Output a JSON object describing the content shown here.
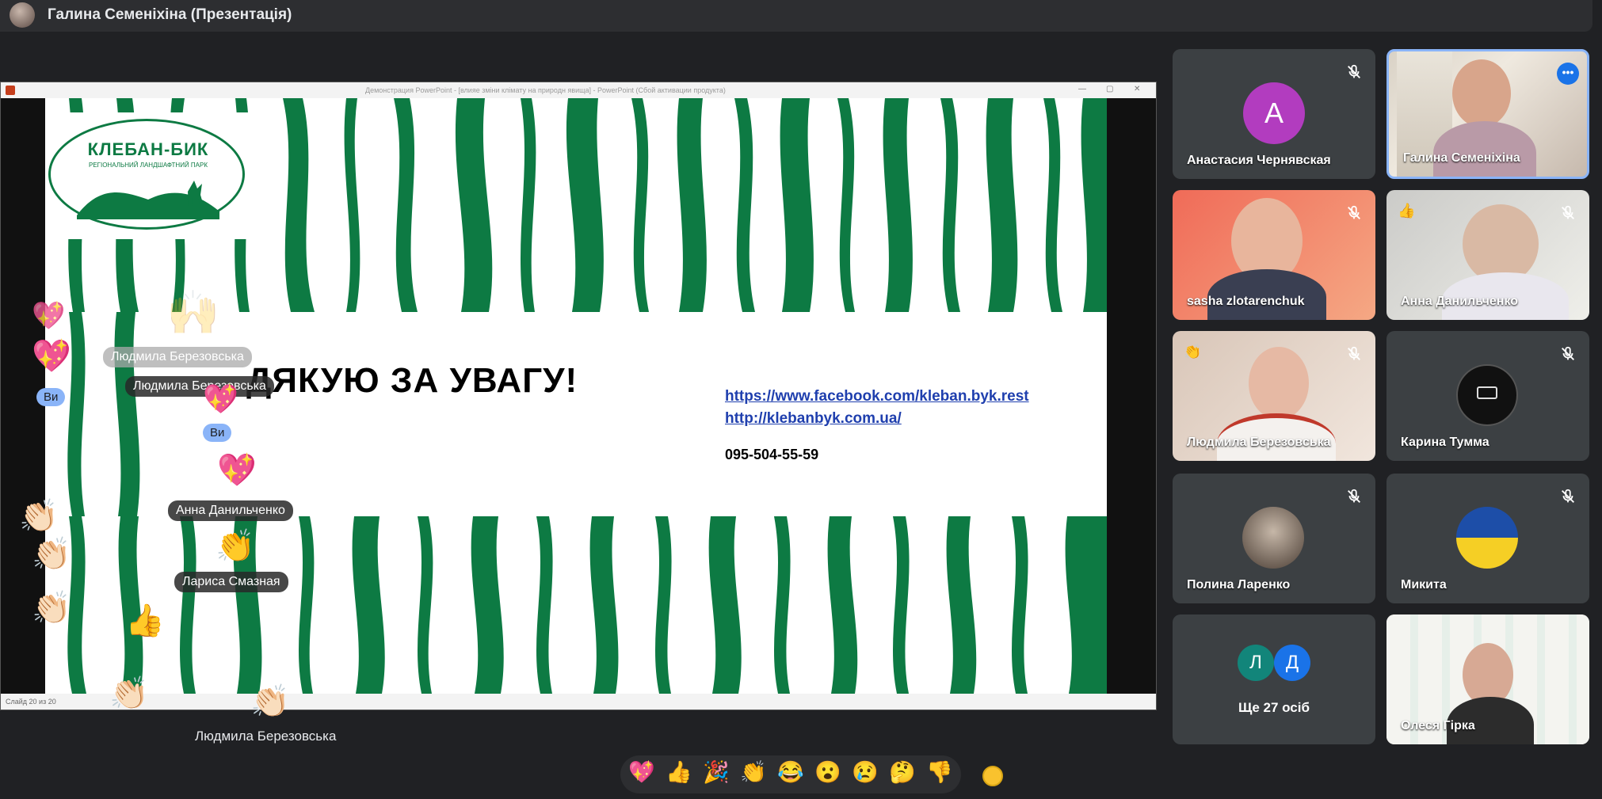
{
  "meeting": {
    "title": "Галина Семеніхіна (Презентація)"
  },
  "presentation": {
    "window_title": "Демонстрация PowerPoint - [влияе зміни клімату на природн явища] - PowerPoint (Сбой активации продукта)",
    "status_left": "Слайд 20 из 20",
    "slide": {
      "logo_name": "КЛЕБАН-БИК",
      "logo_subtitle": "РЕГІОНАЛЬНИЙ ЛАНДШАФТНИЙ ПАРК",
      "heading": "ДЯКУЮ ЗА УВАГУ!",
      "link_facebook": "https://www.facebook.com/kleban.byk.rest",
      "link_site": "http://klebanbyk.com.ua/",
      "phone": "095-504-55-59"
    }
  },
  "reactions": {
    "names": [
      "Людмила Березовська",
      "Людмила Березовська",
      "Анна Данильченко",
      "Лариса Смазная",
      "Людмила Березовська"
    ],
    "you": "Ви"
  },
  "participants": [
    {
      "name": "Анастасия Чернявская",
      "initial": "А",
      "muted": true,
      "avatar_color": "#b23cbf"
    },
    {
      "name": "Галина Семеніхіна",
      "muted": false,
      "presenting": true
    },
    {
      "name": "sasha zlotarenchuk",
      "muted": true
    },
    {
      "name": "Анна Данильченко",
      "muted": true,
      "reaction": "👍"
    },
    {
      "name": "Людмила Березовська",
      "muted": true,
      "reaction": "👏"
    },
    {
      "name": "Карина Тумма",
      "muted": true
    },
    {
      "name": "Полина Ларенко",
      "muted": true
    },
    {
      "name": "Микита",
      "muted": true
    },
    {
      "more_label": "Ще 27 осіб",
      "initials": [
        "Л",
        "Д"
      ],
      "colors": [
        "#12857a",
        "#1a73e8"
      ]
    },
    {
      "name": "Олеся Гірка"
    }
  ],
  "emoji_bar": [
    "💖",
    "👍",
    "🎉",
    "👏",
    "😂",
    "😮",
    "😢",
    "🤔",
    "👎"
  ],
  "icons": [
    "mic-off-icon",
    "more-options-icon",
    "skin-tone-icon"
  ]
}
